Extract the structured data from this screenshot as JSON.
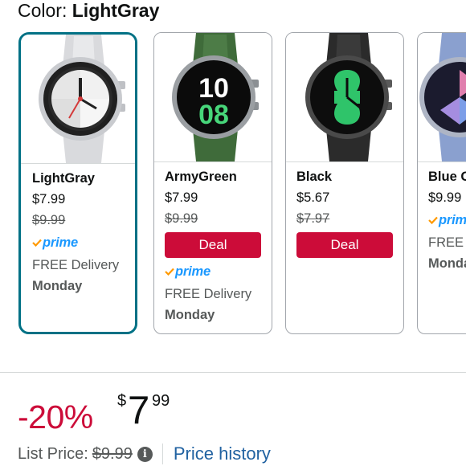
{
  "header": {
    "color_label": "Color:",
    "color_value": "LightGray"
  },
  "colors": {
    "selected_border": "#007185",
    "deal_bg": "#cc0c39",
    "discount": "#cc0c39",
    "prime_blue": "#1a98ff",
    "link": "#2162a1"
  },
  "variants": [
    {
      "name": "LightGray",
      "price": "$7.99",
      "list_price": "$9.99",
      "deal": "",
      "prime": "prime",
      "delivery": "FREE Delivery",
      "day": "Monday",
      "selected": true,
      "band": "#d9dadd",
      "face": "#f5f5f5"
    },
    {
      "name": "ArmyGreen",
      "price": "$7.99",
      "list_price": "$9.99",
      "deal": "Deal",
      "prime": "prime",
      "delivery": "FREE Delivery",
      "day": "Monday",
      "selected": false,
      "band": "#3f6b3a",
      "face": "#101010"
    },
    {
      "name": "Black",
      "price": "$5.67",
      "list_price": "$7.97",
      "deal": "Deal",
      "prime": "",
      "delivery": "",
      "day": "",
      "selected": false,
      "band": "#2b2b2b",
      "face": "#0d0d0d"
    },
    {
      "name": "Blue G",
      "price": "$9.99",
      "list_price": "",
      "deal": "",
      "prime": "prim",
      "delivery": "FREE D",
      "day": "Monda",
      "selected": false,
      "band": "#8aa0cf",
      "face": "#1b1b2e"
    }
  ],
  "watch_face_text": {
    "armygreen_top": "10",
    "armygreen_bottom": "08"
  },
  "pricing": {
    "discount": "-20%",
    "currency": "$",
    "whole": "7",
    "fraction": "99",
    "list_label": "List Price:",
    "list_value": "$9.99",
    "info": "i",
    "history_link": "Price history"
  }
}
